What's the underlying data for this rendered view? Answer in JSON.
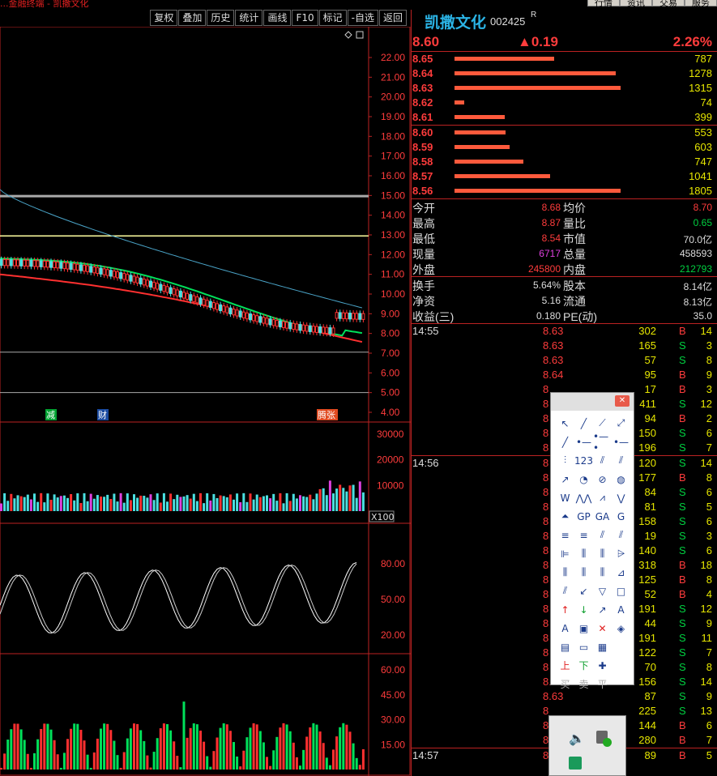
{
  "window": {
    "title": "...金融终端 - 凯撒文化",
    "menu": [
      "行情",
      "资讯",
      "交易",
      "服务"
    ]
  },
  "toolbar": [
    "复权",
    "叠加",
    "历史",
    "统计",
    "画线",
    "F10",
    "标记",
    "-自选",
    "返回"
  ],
  "chart": {
    "price_axis": [
      "22.00",
      "21.00",
      "20.00",
      "19.00",
      "18.00",
      "17.00",
      "16.00",
      "15.00",
      "14.00",
      "13.00",
      "12.00",
      "11.00",
      "10.00",
      "9.00",
      "8.00",
      "7.00",
      "6.00",
      "5.00",
      "4.00"
    ],
    "event_labels": [
      "减",
      "财",
      "腾张"
    ],
    "vol_axis": [
      "30000",
      "20000",
      "10000"
    ],
    "vol_unit": "X100",
    "kdj_axis": [
      "80.00",
      "50.00",
      "20.00"
    ],
    "ind_axis": [
      "60.00",
      "45.00",
      "30.00",
      "15.00"
    ],
    "colors": {
      "up": "#ff3030",
      "down": "#00e05a",
      "ma1": "#ff3030",
      "ma2": "#00e05a",
      "ma3": "#4aa4c8"
    }
  },
  "stock": {
    "name": "凯撒文化",
    "code": "002425",
    "flag": "R",
    "price": "8.60",
    "change": "▲0.19",
    "pct": "2.26%"
  },
  "asks": [
    {
      "p": "8.65",
      "v": "787"
    },
    {
      "p": "8.64",
      "v": "1278"
    },
    {
      "p": "8.63",
      "v": "1315"
    },
    {
      "p": "8.62",
      "v": "74"
    },
    {
      "p": "8.61",
      "v": "399"
    }
  ],
  "bids": [
    {
      "p": "8.60",
      "v": "553"
    },
    {
      "p": "8.59",
      "v": "603"
    },
    {
      "p": "8.58",
      "v": "747"
    },
    {
      "p": "8.57",
      "v": "1041"
    },
    {
      "p": "8.56",
      "v": "1805"
    }
  ],
  "stats": [
    {
      "l1": "今开",
      "v1": "8.68",
      "l2": "均价",
      "v2": "8.70"
    },
    {
      "l1": "最高",
      "v1": "8.87",
      "l2": "量比",
      "v2": "0.65"
    },
    {
      "l1": "最低",
      "v1": "8.54",
      "l2": "市值",
      "v2": "70.0亿"
    },
    {
      "l1": "现量",
      "v1": "6717",
      "l2": "总量",
      "v2": "458593"
    },
    {
      "l1": "外盘",
      "v1": "245800",
      "l2": "内盘",
      "v2": "212793"
    },
    {
      "l1": "换手",
      "v1": "5.64%",
      "l2": "股本",
      "v2": "8.14亿"
    },
    {
      "l1": "净资",
      "v1": "5.16",
      "l2": "流通",
      "v2": "8.13亿"
    },
    {
      "l1": "收益(三)",
      "v1": "0.180",
      "l2": "PE(动)",
      "v2": "35.0"
    }
  ],
  "ticks": [
    {
      "t": "14:55",
      "p": "8.63",
      "v": "302",
      "d": "B",
      "n": "14"
    },
    {
      "t": "",
      "p": "8.63",
      "v": "165",
      "d": "S",
      "n": "3"
    },
    {
      "t": "",
      "p": "8.63",
      "v": "57",
      "d": "S",
      "n": "8"
    },
    {
      "t": "",
      "p": "8.64",
      "v": "95",
      "d": "B",
      "n": "9"
    },
    {
      "t": "",
      "p": "8",
      "v": "17",
      "d": "B",
      "n": "3"
    },
    {
      "t": "",
      "p": "8",
      "v": "411",
      "d": "S",
      "n": "12"
    },
    {
      "t": "",
      "p": "8",
      "v": "94",
      "d": "B",
      "n": "2"
    },
    {
      "t": "",
      "p": "8",
      "v": "150",
      "d": "S",
      "n": "6"
    },
    {
      "t": "",
      "p": "8",
      "v": "196",
      "d": "S",
      "n": "7"
    },
    {
      "t": "14:56",
      "p": "8",
      "v": "120",
      "d": "S",
      "n": "14"
    },
    {
      "t": "",
      "p": "8",
      "v": "177",
      "d": "B",
      "n": "8"
    },
    {
      "t": "",
      "p": "8",
      "v": "84",
      "d": "S",
      "n": "6"
    },
    {
      "t": "",
      "p": "8",
      "v": "81",
      "d": "S",
      "n": "5"
    },
    {
      "t": "",
      "p": "8",
      "v": "158",
      "d": "S",
      "n": "6"
    },
    {
      "t": "",
      "p": "8",
      "v": "19",
      "d": "S",
      "n": "3"
    },
    {
      "t": "",
      "p": "8",
      "v": "140",
      "d": "S",
      "n": "6"
    },
    {
      "t": "",
      "p": "8",
      "v": "318",
      "d": "B",
      "n": "18"
    },
    {
      "t": "",
      "p": "8",
      "v": "125",
      "d": "B",
      "n": "8"
    },
    {
      "t": "",
      "p": "8",
      "v": "52",
      "d": "B",
      "n": "4"
    },
    {
      "t": "",
      "p": "8",
      "v": "191",
      "d": "S",
      "n": "12"
    },
    {
      "t": "",
      "p": "8",
      "v": "44",
      "d": "S",
      "n": "9"
    },
    {
      "t": "",
      "p": "8",
      "v": "191",
      "d": "S",
      "n": "11"
    },
    {
      "t": "",
      "p": "8",
      "v": "122",
      "d": "S",
      "n": "7"
    },
    {
      "t": "",
      "p": "8",
      "v": "70",
      "d": "S",
      "n": "8"
    },
    {
      "t": "",
      "p": "8.63",
      "v": "156",
      "d": "S",
      "n": "14"
    },
    {
      "t": "",
      "p": "8.63",
      "v": "87",
      "d": "S",
      "n": "9"
    },
    {
      "t": "",
      "p": "8",
      "v": "225",
      "d": "S",
      "n": "13"
    },
    {
      "t": "",
      "p": "8",
      "v": "144",
      "d": "B",
      "n": "6"
    },
    {
      "t": "",
      "p": "8",
      "v": "280",
      "d": "B",
      "n": "7"
    },
    {
      "t": "14:57",
      "p": "8",
      "v": "89",
      "d": "B",
      "n": "5"
    }
  ],
  "tools": [
    "↖",
    "╱",
    "⟋",
    "⤢",
    "╱",
    "•—",
    "•—•",
    "•—",
    "⫶",
    "123",
    "⫽",
    "⫽",
    "↗",
    "◔",
    "⊘",
    "◍",
    "W",
    "⋀⋀",
    "⩘",
    "⋁",
    "⏶",
    "GP",
    "GA",
    "G",
    "≡",
    "≡",
    "⫽",
    "⫽",
    "⊫",
    "⫼",
    "⫼",
    "⩥",
    "⫼",
    "⫼",
    "⫼",
    "⊿",
    "⫽",
    "↙",
    "▽",
    "□",
    "↑",
    "↓",
    "↗",
    "A",
    "A",
    "▣",
    "✕",
    "◈",
    "▤",
    "▭",
    "▦",
    "",
    "上",
    "下",
    "✚",
    "",
    "买",
    "卖",
    "平",
    ""
  ]
}
